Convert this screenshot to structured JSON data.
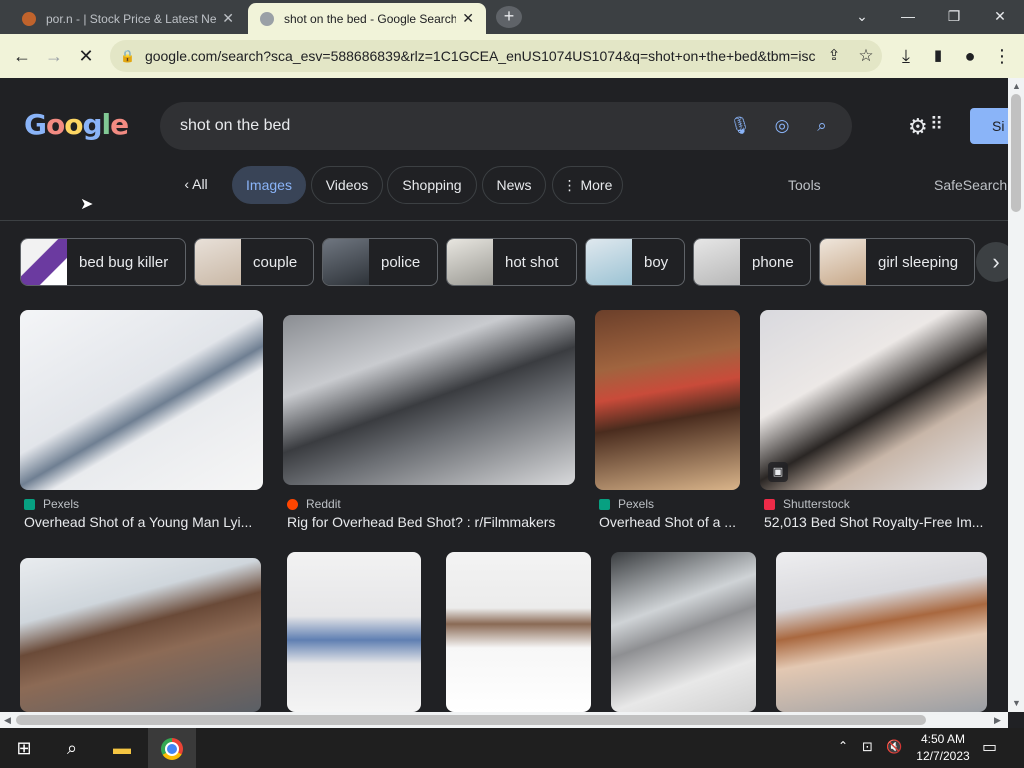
{
  "tabs": [
    {
      "title": "por.n - | Stock Price & Latest News",
      "active": false
    },
    {
      "title": "shot on the bed - Google Search",
      "active": true
    }
  ],
  "toolbar": {
    "url": "google.com/search?sca_esv=588686839&rlz=1C1GCEA_enUS1074US1074&q=shot+on+the+bed&tbm=isch"
  },
  "search": {
    "query": "shot on the bed",
    "signin_label": "Si"
  },
  "logo": "Google",
  "nav": {
    "all": "All",
    "images": "Images",
    "videos": "Videos",
    "shopping": "Shopping",
    "news": "News",
    "more": "More",
    "tools": "Tools",
    "safesearch": "SafeSearch"
  },
  "chips": [
    "bed bug killer",
    "couple",
    "police",
    "hot shot",
    "boy",
    "phone",
    "girl sleeping"
  ],
  "results": [
    {
      "source": "Pexels",
      "title": "Overhead Shot of a Young Man Lyi...",
      "source_color": "#07a081"
    },
    {
      "source": "Reddit",
      "title": "Rig for Overhead Bed Shot? : r/Filmmakers",
      "source_color": "#ff4500"
    },
    {
      "source": "Pexels",
      "title": "Overhead Shot of a ...",
      "source_color": "#07a081"
    },
    {
      "source": "Shutterstock",
      "title": "52,013 Bed Shot Royalty-Free Im...",
      "source_color": "#ee2b48"
    }
  ],
  "taskbar": {
    "time": "4:50 AM",
    "date": "12/7/2023"
  },
  "colors": {
    "accent": "#8ab4f8",
    "background": "#202124",
    "toolbar": "#f1f3d9"
  }
}
